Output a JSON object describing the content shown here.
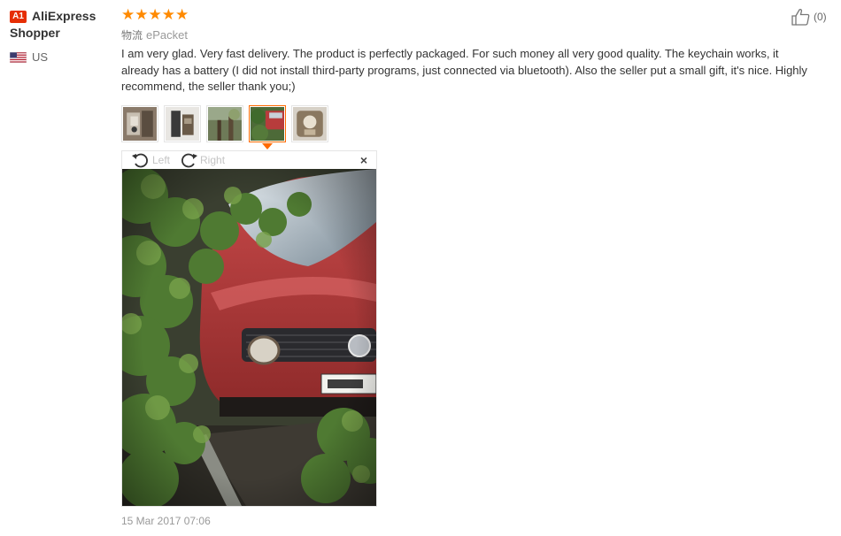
{
  "user": {
    "level_badge": "A1",
    "name": "AliExpress Shopper",
    "country": "US",
    "flag_icon": "us-flag-icon"
  },
  "review": {
    "rating": 5,
    "stars": [
      "★",
      "★",
      "★",
      "★",
      "★"
    ],
    "logistics_label": "物流",
    "logistics_value": "ePacket",
    "text": "I am very glad. Very fast delivery. The product is perfectly packaged. For such money all very good quality. The keychain works, it already has a battery (I did not install third-party programs, just connected via bluetooth). Also the seller put a small gift, it's nice. Highly recommend, the seller thank you;)",
    "date": "15 Mar 2017 07:06"
  },
  "helpful": {
    "icon": "thumbs-up-icon",
    "count": "(0)"
  },
  "thumbnails": {
    "count": 5,
    "active_index": 3
  },
  "viewer": {
    "rotate_left_label": "Left",
    "rotate_right_label": "Right",
    "close_glyph": "×"
  },
  "colors": {
    "accent": "#ff6a00",
    "star": "#ff8a00",
    "badge": "#e62e04",
    "muted_text": "#999999"
  }
}
